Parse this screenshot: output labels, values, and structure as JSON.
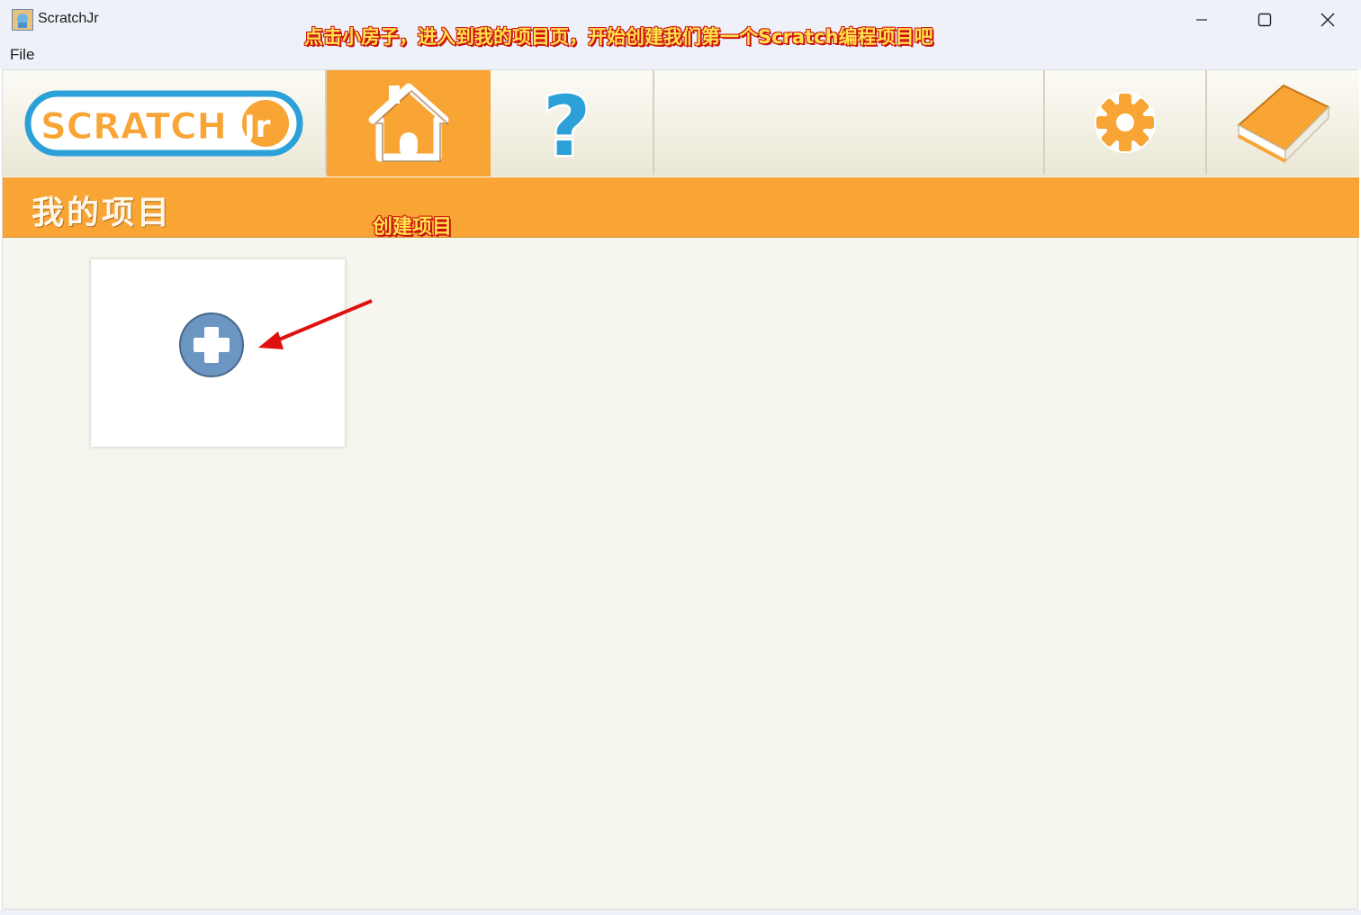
{
  "window": {
    "title": "ScratchJr",
    "menu": [
      "File"
    ],
    "controls": {
      "minimize_icon": "minimize-icon",
      "maximize_icon": "maximize-icon",
      "close_icon": "close-icon"
    }
  },
  "annotations": {
    "top": "点击小房子，进入到我的项目页，开始创建我们第一个Scratch编程项目吧",
    "create": "创建项目"
  },
  "logo": {
    "text": "SCRATCH",
    "suffix": "Jr"
  },
  "toolbar": {
    "tabs": [
      {
        "name": "home",
        "icon": "home-icon",
        "selected": true
      },
      {
        "name": "help",
        "icon": "question-icon",
        "selected": false
      },
      {
        "name": "settings",
        "icon": "gear-icon",
        "selected": false
      },
      {
        "name": "book",
        "icon": "book-icon",
        "selected": false
      }
    ]
  },
  "page": {
    "title": "我的项目",
    "new_project_icon": "plus-icon"
  },
  "colors": {
    "accent": "#f8a535",
    "plus_button": "#6b96c2",
    "logo_blue": "#2ca0d8",
    "annotation_text": "#ffe14a",
    "annotation_outline": "#cc1111"
  }
}
